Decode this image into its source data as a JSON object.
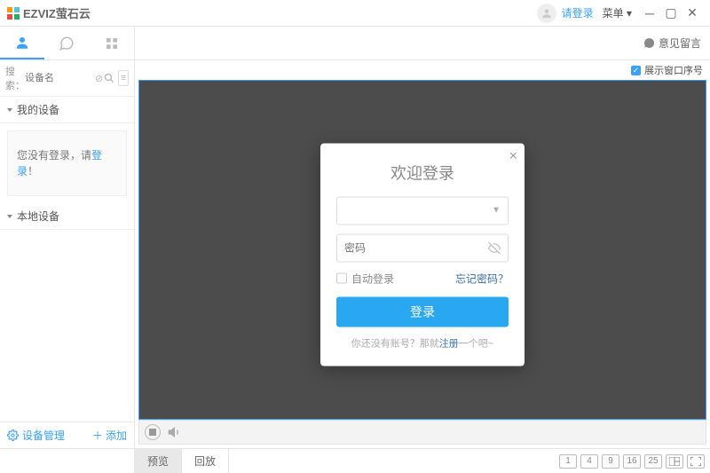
{
  "titlebar": {
    "app_name": "EZVIZ萤石云",
    "login_link": "请登录",
    "menu_label": "菜单"
  },
  "tabbar": {
    "feedback": "意见留言"
  },
  "sidebar": {
    "search_label": "搜索：",
    "search_placeholder": "设备名",
    "groups": {
      "my_devices": "我的设备",
      "local_devices": "本地设备"
    },
    "not_logged_prefix": "您没有登录，请",
    "not_logged_link": "登录",
    "not_logged_suffix": "！",
    "device_mgmt": "设备管理",
    "add": "添加"
  },
  "video": {
    "show_index_label": "展示窗口序号"
  },
  "bottombar": {
    "preview": "预览",
    "playback": "回放",
    "layouts": [
      "1",
      "4",
      "9",
      "16",
      "25"
    ]
  },
  "login_dialog": {
    "title": "欢迎登录",
    "username_placeholder": "",
    "password_placeholder": "密码",
    "auto_login": "自动登录",
    "forgot": "忘记密码？",
    "login_btn": "登录",
    "register_prefix": "你还没有账号？那就",
    "register_link": "注册",
    "register_suffix": "一个吧~"
  }
}
